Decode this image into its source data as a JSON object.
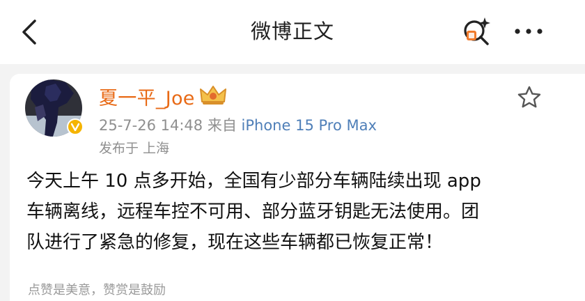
{
  "header": {
    "title": "微博正文"
  },
  "post": {
    "author": "夏一平_Joe",
    "timestamp": "25-7-26 14:48",
    "source_prefix": "来自",
    "source_device": "iPhone 15 Pro Max",
    "location": "发布于 上海",
    "content_lines": [
      "今天上午 10 点多开始，全国有少部分车辆陆续出现 app",
      "车辆离线，远程车控不可用、部分蓝牙钥匙无法使用。团",
      "队进行了紧急的修复，现在这些车辆都已恢复正常！"
    ],
    "footer": "点赞是美意，赞赏是鼓励"
  },
  "icons": {
    "back": "chevron-left-icon",
    "search": "search-icon",
    "more": "more-dots-icon",
    "favorite": "star-icon",
    "verified": "verified-v-icon",
    "membership": "crown-icon"
  },
  "colors": {
    "username": "#e86a16",
    "source": "#4f7fb8",
    "secondary_text": "#8f8f8f",
    "verified_badge": "#f5b400",
    "search_badge": "#f07a2b"
  }
}
